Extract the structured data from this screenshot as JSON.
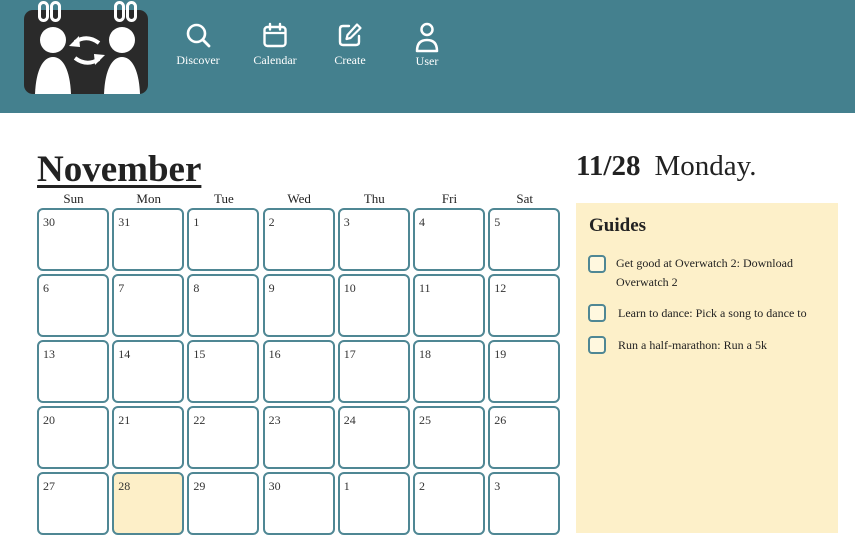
{
  "nav": {
    "items": [
      {
        "label": "Discover",
        "icon": "search-icon"
      },
      {
        "label": "Calendar",
        "icon": "calendar-icon"
      },
      {
        "label": "Create",
        "icon": "edit-icon"
      },
      {
        "label": "User",
        "icon": "user-icon"
      }
    ]
  },
  "calendar": {
    "month": "November",
    "weekdays": [
      "Sun",
      "Mon",
      "Tue",
      "Wed",
      "Thu",
      "Fri",
      "Sat"
    ],
    "weeks": [
      [
        "30",
        "31",
        "1",
        "2",
        "3",
        "4",
        "5"
      ],
      [
        "6",
        "7",
        "8",
        "9",
        "10",
        "11",
        "12"
      ],
      [
        "13",
        "14",
        "15",
        "16",
        "17",
        "18",
        "19"
      ],
      [
        "20",
        "21",
        "22",
        "23",
        "24",
        "25",
        "26"
      ],
      [
        "27",
        "28",
        "29",
        "30",
        "1",
        "2",
        "3"
      ]
    ],
    "highlighted_day": "28"
  },
  "selected": {
    "date": "11/28",
    "weekday": "Monday."
  },
  "guides": {
    "title": "Guides",
    "items": [
      {
        "text": "Get good at Overwatch 2: Download Overwatch 2"
      },
      {
        "text": "Learn to dance: Pick a song to dance to"
      },
      {
        "text": "Run a half-marathon: Run a 5k"
      }
    ]
  },
  "colors": {
    "header": "#44808e",
    "cell_border": "#4f8794",
    "highlight": "#fdefc8",
    "panel": "#fdf0c9"
  }
}
